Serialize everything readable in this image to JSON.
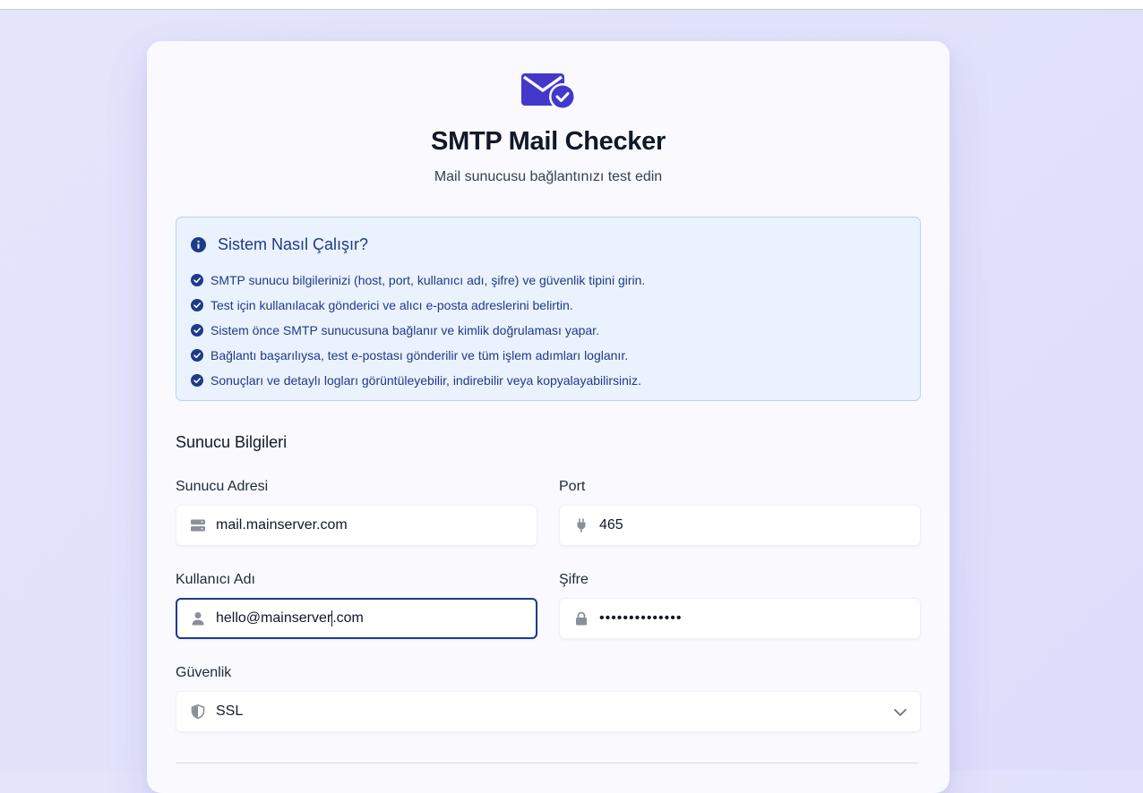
{
  "app": {
    "title": "SMTP Mail Checker",
    "subtitle": "Mail sunucusu bağlantınızı test edin",
    "logo_icon": "mail-check-icon"
  },
  "info": {
    "title": "Sistem Nasıl Çalışır?",
    "icon": "info-circle-icon",
    "items": [
      "SMTP sunucu bilgilerinizi (host, port, kullanıcı adı, şifre) ve güvenlik tipini girin.",
      "Test için kullanılacak gönderici ve alıcı e-posta adreslerini belirtin.",
      "Sistem önce SMTP sunucusuna bağlanır ve kimlik doğrulaması yapar.",
      "Bağlantı başarılıysa, test e-postası gönderilir ve tüm işlem adımları loglanır.",
      "Sonuçları ve detaylı logları görüntüleyebilir, indirebilir veya kopyalayabilirsiniz."
    ]
  },
  "form": {
    "section_title": "Sunucu Bilgileri",
    "host": {
      "label": "Sunucu Adresi",
      "value": "mail.mainserver.com",
      "icon": "server-icon"
    },
    "port": {
      "label": "Port",
      "value": "465",
      "icon": "plug-icon"
    },
    "username": {
      "label": "Kullanıcı Adı",
      "value_before_caret": "hello@mainserver",
      "value_after_caret": ".com",
      "icon": "user-icon"
    },
    "password": {
      "label": "Şifre",
      "value": "••••••••••••••",
      "icon": "lock-icon"
    },
    "security": {
      "label": "Güvenlik",
      "value": "SSL",
      "icon": "shield-icon",
      "options_visible": [
        "SSL"
      ]
    }
  },
  "colors": {
    "accent": "#4338ca",
    "info_text": "#1e3a8a",
    "info_bg": "#eaf2fd",
    "info_border": "#b8d4f4",
    "focus_border": "#1e3a8a"
  }
}
